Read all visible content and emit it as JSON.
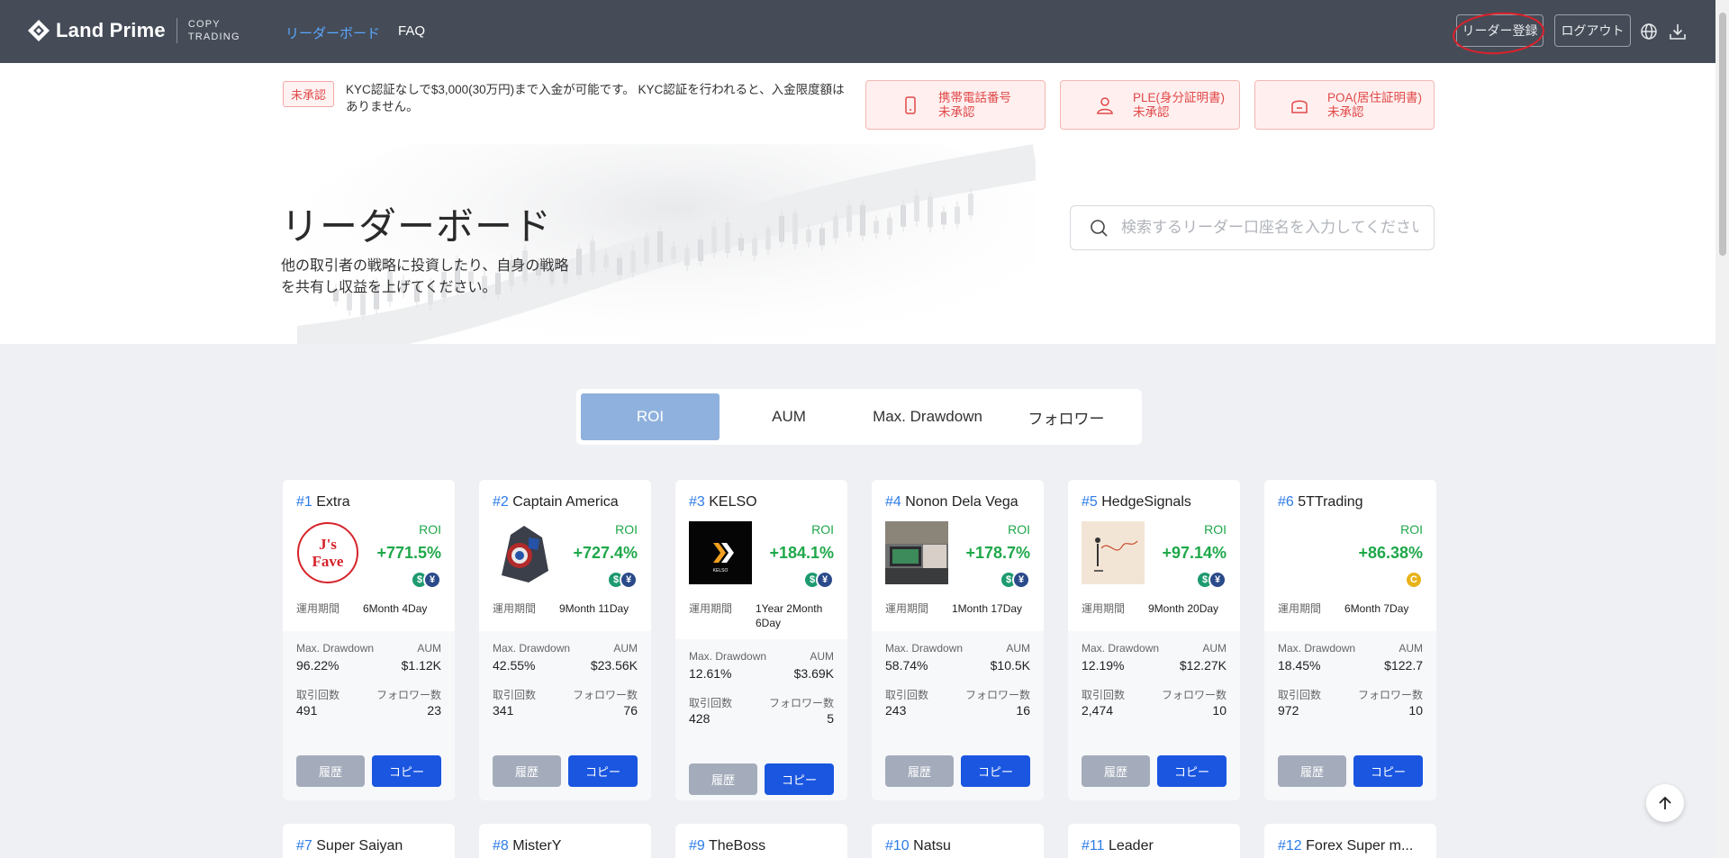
{
  "header": {
    "logo_text": "Land Prime",
    "logo_sub_line1": "COPY",
    "logo_sub_line2": "TRADING",
    "nav": [
      {
        "label": "リーダーボード",
        "active": true
      },
      {
        "label": "FAQ",
        "active": false
      }
    ],
    "register_label": "リーダー登録",
    "logout_label": "ログアウト",
    "icons": [
      "globe-icon",
      "download-icon"
    ]
  },
  "kyc": {
    "badge": "未承認",
    "message": "KYC認証なしで$3,000(30万円)まで入金が可能です。 KYC認証を行われると、入金限度額はありません。",
    "cards": [
      {
        "line1": "携帯電話番号",
        "line2": "未承認",
        "icon": "phone-icon"
      },
      {
        "line1": "PLE(身分証明書)",
        "line2": "未承認",
        "icon": "user-icon"
      },
      {
        "line1": "POA(居住証明書)",
        "line2": "未承認",
        "icon": "home-icon"
      }
    ]
  },
  "hero": {
    "title": "リーダーボード",
    "subtitle": "他の取引者の戦略に投資したり、自身の戦略を共有し収益を上げてください。",
    "search_placeholder": "検索するリーダー口座名を入力してください"
  },
  "tabs": [
    {
      "label": "ROI",
      "active": true
    },
    {
      "label": "AUM",
      "active": false
    },
    {
      "label": "Max. Drawdown",
      "active": false
    },
    {
      "label": "フォロワー",
      "active": false
    }
  ],
  "labels": {
    "roi": "ROI",
    "period": "運用期間",
    "max_drawdown": "Max. Drawdown",
    "aum": "AUM",
    "trades": "取引回数",
    "followers": "フォロワー数",
    "history": "履歴",
    "copy": "コピー"
  },
  "leaders": [
    {
      "rank": "#1",
      "name": "Extra",
      "roi": "+771.5%",
      "period": "6Month 4Day",
      "max_drawdown": "96.22%",
      "aum": "$1.12K",
      "trades": "491",
      "followers": "23",
      "coins": [
        "usd",
        "jpy"
      ],
      "thumb": "jsfave"
    },
    {
      "rank": "#2",
      "name": "Captain America",
      "roi": "+727.4%",
      "period": "9Month 11Day",
      "max_drawdown": "42.55%",
      "aum": "$23.56K",
      "trades": "341",
      "followers": "76",
      "coins": [
        "usd",
        "jpy"
      ],
      "thumb": "captain"
    },
    {
      "rank": "#3",
      "name": "KELSO",
      "roi": "+184.1%",
      "period": "1Year 2Month 6Day",
      "max_drawdown": "12.61%",
      "aum": "$3.69K",
      "trades": "428",
      "followers": "5",
      "coins": [
        "usd",
        "jpy"
      ],
      "thumb": "kelso"
    },
    {
      "rank": "#4",
      "name": "Nonon Dela Vega",
      "roi": "+178.7%",
      "period": "1Month 17Day",
      "max_drawdown": "58.74%",
      "aum": "$10.5K",
      "trades": "243",
      "followers": "16",
      "coins": [
        "usd",
        "jpy"
      ],
      "thumb": "desk"
    },
    {
      "rank": "#5",
      "name": "HedgeSignals",
      "roi": "+97.14%",
      "period": "9Month 20Day",
      "max_drawdown": "12.19%",
      "aum": "$12.27K",
      "trades": "2,474",
      "followers": "10",
      "coins": [
        "usd",
        "jpy"
      ],
      "thumb": "sketch"
    },
    {
      "rank": "#6",
      "name": "5TTrading",
      "roi": "+86.38%",
      "period": "6Month 7Day",
      "max_drawdown": "18.45%",
      "aum": "$122.7",
      "trades": "972",
      "followers": "10",
      "coins": [
        "usdc"
      ],
      "thumb": "none"
    }
  ],
  "leaders_row2": [
    {
      "rank": "#7",
      "name": "Super Saiyan"
    },
    {
      "rank": "#8",
      "name": "MisterY"
    },
    {
      "rank": "#9",
      "name": "TheBoss"
    },
    {
      "rank": "#10",
      "name": "Natsu"
    },
    {
      "rank": "#11",
      "name": "Leader"
    },
    {
      "rank": "#12",
      "name": "Forex Super m..."
    }
  ],
  "thumb_texts": {
    "jsfave_line1": "J's",
    "jsfave_line2": "Fave",
    "kelso_logo": "KELSO"
  },
  "colors": {
    "topbar": "#454c57",
    "accent_blue": "#2e7ce8",
    "roi_green": "#1fa84a",
    "copy_button": "#1a56e0",
    "alert_red": "#e04848"
  }
}
